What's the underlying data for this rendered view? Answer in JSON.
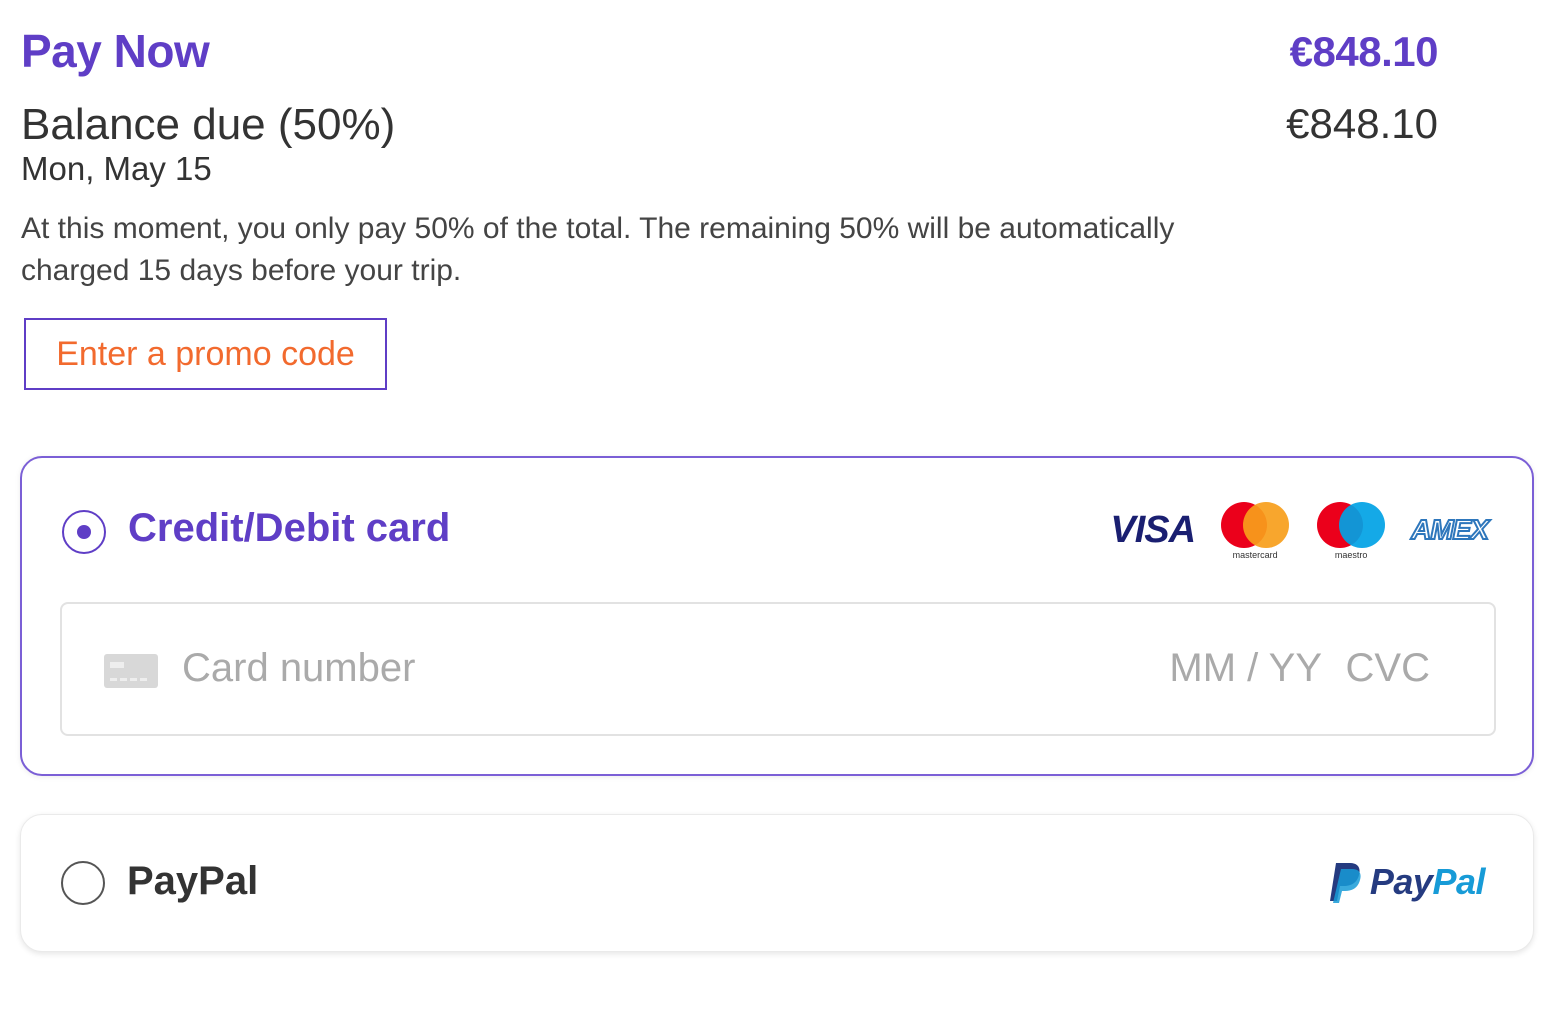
{
  "summary": {
    "title": "Pay Now",
    "total": "€848.10",
    "balance_label": "Balance due (50%)",
    "balance_amount": "€848.10",
    "balance_date": "Mon, May 15",
    "note": "At this moment, you only pay 50% of the total. The remaining 50% will be automatically charged 15 days before your trip."
  },
  "promo": {
    "label": "Enter a promo code"
  },
  "payment_methods": {
    "card": {
      "label": "Credit/Debit card",
      "selected": true,
      "brands": {
        "visa": "VISA",
        "mastercard": "mastercard",
        "maestro": "maestro",
        "amex": "AMEX"
      },
      "number_placeholder": "Card number",
      "expiry_placeholder": "MM / YY",
      "cvc_placeholder": "CVC"
    },
    "paypal": {
      "label": "PayPal",
      "selected": false,
      "logo_pay": "Pay",
      "logo_pal": "Pal"
    }
  },
  "colors": {
    "accent": "#5f3ec6",
    "promo_text": "#f26a2e",
    "paypal_dark": "#253b80",
    "paypal_light": "#179bd7"
  },
  "icons": {
    "card_placeholder": "credit-card-icon",
    "paypal_mark": "paypal-p-icon"
  }
}
